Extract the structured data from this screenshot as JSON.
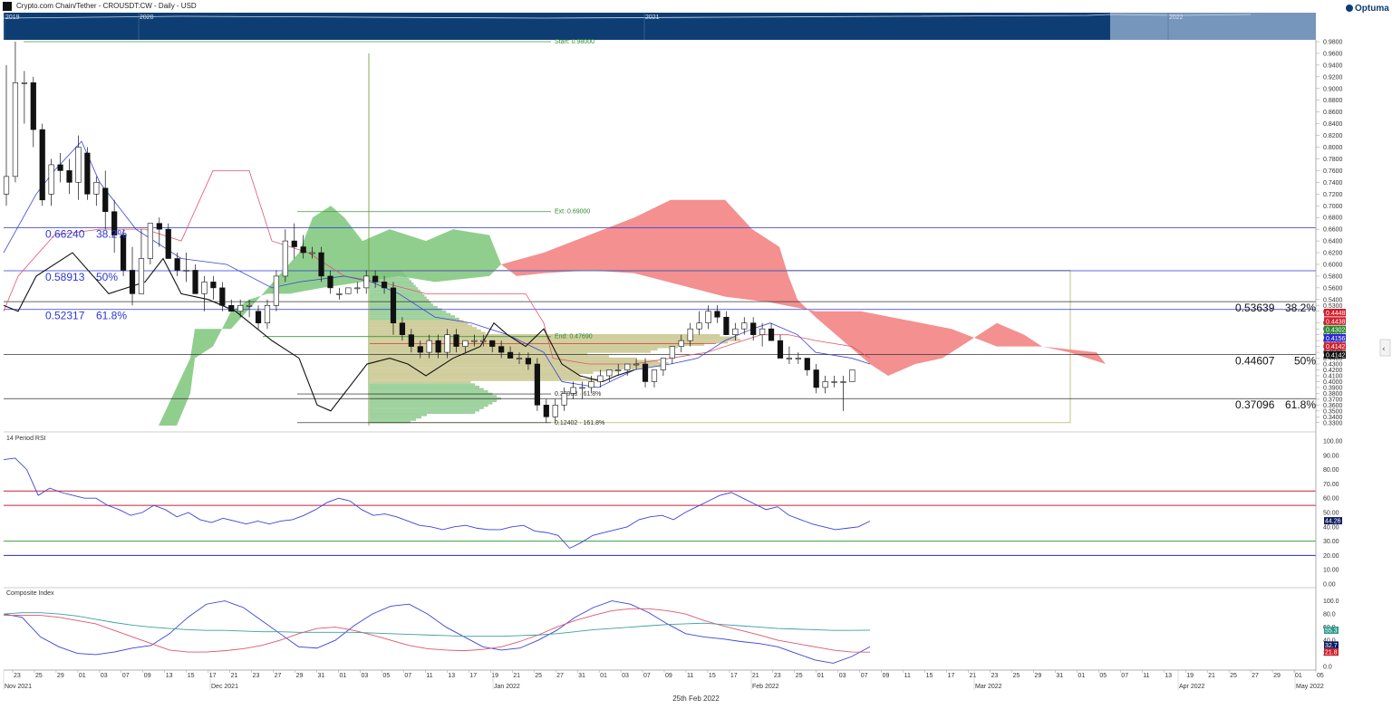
{
  "header": {
    "title": "Crypto.com Chain/Tether - CROUSDT:CW - Daily - USD",
    "logo": "Optuma",
    "navigator_years": [
      "2019",
      "2020",
      "2021",
      "2022"
    ],
    "footer_date": "25th Feb 2022"
  },
  "colors": {
    "bull_cloud": "#7dc67a",
    "bear_cloud": "#f27c7c",
    "tenkan": "#3a44d8",
    "kijun": "#e0566c",
    "lagging": "#111111",
    "volume_profile_green": "#8cc98c",
    "volume_profile_tan": "#c8c48c",
    "navigator_bg": "#0e3d73",
    "rsi_line": "#3a44d8",
    "rsi_upper": "#c8203a",
    "rsi_lower": "#3aa03a",
    "ci_line": "#3a44d8",
    "ci_fast_ma": "#e0566c",
    "ci_slow_ma": "#3aa0a0"
  },
  "chart_data": [
    {
      "type": "candlestick",
      "name": "price",
      "y_axis": [
        "0.9800",
        "0.9600",
        "0.9400",
        "0.9200",
        "0.9000",
        "0.8800",
        "0.8600",
        "0.8400",
        "0.8200",
        "0.8000",
        "0.7800",
        "0.7600",
        "0.7400",
        "0.7200",
        "0.7000",
        "0.6800",
        "0.6600",
        "0.6400",
        "0.6200",
        "0.6000",
        "0.5800",
        "0.5600",
        "0.5400",
        "0.5300",
        "0.5200",
        "0.5000",
        "0.4900",
        "0.4800",
        "0.4700",
        "0.4600",
        "0.4500",
        "0.4400",
        "0.4300",
        "0.4200",
        "0.4100",
        "0.4000",
        "0.3900",
        "0.3800",
        "0.3700",
        "0.3600",
        "0.3500",
        "0.3400",
        "0.3300"
      ],
      "ylim": [
        0.325,
        0.98
      ],
      "candles": [
        [
          0.72,
          0.94,
          0.7,
          0.75
        ],
        [
          0.75,
          0.98,
          0.74,
          0.91
        ],
        [
          0.91,
          0.93,
          0.84,
          0.91
        ],
        [
          0.91,
          0.92,
          0.8,
          0.83
        ],
        [
          0.83,
          0.84,
          0.7,
          0.71
        ],
        [
          0.72,
          0.78,
          0.7,
          0.77
        ],
        [
          0.77,
          0.79,
          0.74,
          0.76
        ],
        [
          0.76,
          0.78,
          0.72,
          0.74
        ],
        [
          0.74,
          0.82,
          0.71,
          0.8
        ],
        [
          0.79,
          0.8,
          0.71,
          0.72
        ],
        [
          0.72,
          0.75,
          0.7,
          0.74
        ],
        [
          0.73,
          0.76,
          0.66,
          0.69
        ],
        [
          0.69,
          0.71,
          0.62,
          0.65
        ],
        [
          0.65,
          0.66,
          0.58,
          0.59
        ],
        [
          0.59,
          0.63,
          0.53,
          0.55
        ],
        [
          0.55,
          0.66,
          0.55,
          0.61
        ],
        [
          0.61,
          0.67,
          0.6,
          0.67
        ],
        [
          0.67,
          0.68,
          0.63,
          0.66
        ],
        [
          0.66,
          0.67,
          0.61,
          0.61
        ],
        [
          0.61,
          0.62,
          0.58,
          0.59
        ],
        [
          0.59,
          0.62,
          0.57,
          0.59
        ],
        [
          0.59,
          0.6,
          0.55,
          0.55
        ],
        [
          0.55,
          0.58,
          0.52,
          0.57
        ],
        [
          0.57,
          0.58,
          0.54,
          0.56
        ],
        [
          0.56,
          0.57,
          0.52,
          0.53
        ],
        [
          0.53,
          0.54,
          0.52,
          0.52
        ],
        [
          0.52,
          0.54,
          0.51,
          0.53
        ],
        [
          0.53,
          0.54,
          0.51,
          0.53
        ],
        [
          0.52,
          0.53,
          0.49,
          0.5
        ],
        [
          0.5,
          0.54,
          0.49,
          0.53
        ],
        [
          0.53,
          0.59,
          0.52,
          0.58
        ],
        [
          0.58,
          0.66,
          0.57,
          0.64
        ],
        [
          0.64,
          0.67,
          0.61,
          0.63
        ],
        [
          0.63,
          0.65,
          0.61,
          0.62
        ],
        [
          0.62,
          0.63,
          0.61,
          0.62
        ],
        [
          0.62,
          0.63,
          0.57,
          0.58
        ],
        [
          0.58,
          0.59,
          0.55,
          0.56
        ],
        [
          0.55,
          0.56,
          0.54,
          0.55
        ],
        [
          0.55,
          0.56,
          0.55,
          0.56
        ],
        [
          0.56,
          0.57,
          0.55,
          0.56
        ],
        [
          0.56,
          0.59,
          0.55,
          0.58
        ],
        [
          0.58,
          0.59,
          0.56,
          0.57
        ],
        [
          0.57,
          0.58,
          0.55,
          0.56
        ],
        [
          0.56,
          0.57,
          0.48,
          0.5
        ],
        [
          0.5,
          0.51,
          0.47,
          0.48
        ],
        [
          0.48,
          0.49,
          0.45,
          0.46
        ],
        [
          0.46,
          0.47,
          0.44,
          0.45
        ],
        [
          0.45,
          0.48,
          0.44,
          0.47
        ],
        [
          0.47,
          0.48,
          0.44,
          0.45
        ],
        [
          0.45,
          0.49,
          0.44,
          0.48
        ],
        [
          0.48,
          0.49,
          0.45,
          0.46
        ],
        [
          0.46,
          0.47,
          0.45,
          0.47
        ],
        [
          0.47,
          0.48,
          0.46,
          0.47
        ],
        [
          0.47,
          0.48,
          0.46,
          0.47
        ],
        [
          0.47,
          0.47,
          0.45,
          0.46
        ],
        [
          0.46,
          0.47,
          0.44,
          0.45
        ],
        [
          0.45,
          0.46,
          0.44,
          0.44
        ],
        [
          0.44,
          0.45,
          0.43,
          0.44
        ],
        [
          0.44,
          0.45,
          0.42,
          0.43
        ],
        [
          0.43,
          0.44,
          0.35,
          0.36
        ],
        [
          0.36,
          0.37,
          0.33,
          0.34
        ],
        [
          0.34,
          0.37,
          0.33,
          0.36
        ],
        [
          0.36,
          0.39,
          0.35,
          0.38
        ],
        [
          0.38,
          0.4,
          0.37,
          0.39
        ],
        [
          0.39,
          0.4,
          0.37,
          0.39
        ],
        [
          0.39,
          0.41,
          0.38,
          0.4
        ],
        [
          0.4,
          0.42,
          0.39,
          0.41
        ],
        [
          0.41,
          0.42,
          0.4,
          0.42
        ],
        [
          0.42,
          0.43,
          0.41,
          0.42
        ],
        [
          0.42,
          0.43,
          0.41,
          0.43
        ],
        [
          0.43,
          0.44,
          0.42,
          0.43
        ],
        [
          0.43,
          0.44,
          0.39,
          0.4
        ],
        [
          0.4,
          0.42,
          0.39,
          0.42
        ],
        [
          0.42,
          0.44,
          0.41,
          0.44
        ],
        [
          0.44,
          0.46,
          0.43,
          0.46
        ],
        [
          0.46,
          0.48,
          0.45,
          0.47
        ],
        [
          0.47,
          0.5,
          0.46,
          0.49
        ],
        [
          0.49,
          0.52,
          0.48,
          0.5
        ],
        [
          0.5,
          0.53,
          0.49,
          0.52
        ],
        [
          0.52,
          0.53,
          0.5,
          0.51
        ],
        [
          0.51,
          0.52,
          0.48,
          0.48
        ],
        [
          0.48,
          0.5,
          0.47,
          0.49
        ],
        [
          0.49,
          0.51,
          0.48,
          0.5
        ],
        [
          0.5,
          0.51,
          0.47,
          0.48
        ],
        [
          0.48,
          0.5,
          0.46,
          0.49
        ],
        [
          0.49,
          0.5,
          0.47,
          0.47
        ],
        [
          0.47,
          0.48,
          0.44,
          0.44
        ],
        [
          0.44,
          0.46,
          0.43,
          0.44
        ],
        [
          0.44,
          0.45,
          0.43,
          0.44
        ],
        [
          0.44,
          0.44,
          0.41,
          0.42
        ],
        [
          0.42,
          0.43,
          0.38,
          0.39
        ],
        [
          0.39,
          0.41,
          0.38,
          0.4
        ],
        [
          0.4,
          0.41,
          0.39,
          0.4
        ],
        [
          0.4,
          0.41,
          0.35,
          0.4
        ],
        [
          0.4,
          0.42,
          0.4,
          0.42
        ]
      ],
      "fib_left": [
        {
          "value": "0.66240",
          "ratio": "38.2%",
          "y": 0.6624
        },
        {
          "value": "0.58913",
          "ratio": "50%",
          "y": 0.58913
        },
        {
          "value": "0.52317",
          "ratio": "61.8%",
          "y": 0.52317
        }
      ],
      "fib_right": [
        {
          "value": "0.53639",
          "ratio": "38.2%",
          "y": 0.53639
        },
        {
          "value": "0.44607",
          "ratio": "50%",
          "y": 0.44607
        },
        {
          "value": "0.37096",
          "ratio": "61.8%",
          "y": 0.37096
        }
      ],
      "annotations": {
        "start": "Start: 0.98000",
        "ext": "Ext: 0.69000",
        "end": "End: 0.47690",
        "fib618": "0.37908 · 61.8%",
        "fib1618": "0.12402 · 161.8%"
      },
      "price_tags": [
        {
          "label": "0.4448",
          "color": "#d0202c"
        },
        {
          "label": "0.4438",
          "color": "#d0202c"
        },
        {
          "label": "0.4302",
          "color": "#2e8a2e"
        },
        {
          "label": "0.4156",
          "color": "#2a2ad0"
        },
        {
          "label": "0.4142",
          "color": "#d0202c"
        },
        {
          "label": "0.4142",
          "color": "#111111"
        }
      ]
    },
    {
      "type": "line",
      "name": "14 Period RSI",
      "y_axis": [
        "100.00",
        "90.00",
        "80.00",
        "70.00",
        "60.00",
        "50.00",
        "40.00",
        "30.00",
        "20.00",
        "10.00",
        "0.00"
      ],
      "ylim": [
        0,
        100
      ],
      "levels": [
        65,
        55,
        30,
        20
      ],
      "series": [
        {
          "name": "",
          "values": [
            87,
            88,
            80,
            62,
            67,
            64,
            62,
            60,
            60,
            55,
            52,
            48,
            50,
            55,
            52,
            47,
            50,
            45,
            43,
            46,
            44,
            42,
            44,
            42,
            44,
            45,
            48,
            52,
            57,
            60,
            58,
            52,
            48,
            49,
            47,
            44,
            41,
            40,
            38,
            40,
            41,
            39,
            38,
            38,
            40,
            41,
            37,
            36,
            34,
            25,
            29,
            34,
            36,
            38,
            40,
            45,
            47,
            48,
            45,
            50,
            54,
            58,
            62,
            64,
            60,
            56,
            52,
            54,
            48,
            45,
            42,
            40,
            38,
            39,
            40,
            44
          ]
        }
      ],
      "last": "44.26"
    },
    {
      "type": "line",
      "name": "Composite Index",
      "y_axis": [
        "100.0",
        "80.0",
        "60.0",
        "40.0",
        "20.0",
        "0.0"
      ],
      "ylim": [
        0,
        105
      ],
      "series": [
        {
          "name": "",
          "values": [
            80,
            75,
            45,
            30,
            20,
            18,
            22,
            28,
            32,
            50,
            75,
            95,
            100,
            90,
            70,
            50,
            30,
            28,
            40,
            62,
            80,
            92,
            95,
            80,
            60,
            45,
            30,
            25,
            28,
            40,
            55,
            75,
            90,
            100,
            95,
            82,
            65,
            50,
            45,
            42,
            38,
            35,
            30,
            20,
            10,
            5,
            15,
            30
          ]
        },
        {
          "name": "",
          "values": [
            78,
            78,
            78,
            75,
            70,
            65,
            55,
            45,
            35,
            25,
            22,
            22,
            24,
            27,
            32,
            40,
            50,
            58,
            60,
            55,
            48,
            40,
            32,
            27,
            25,
            24,
            26,
            30,
            38,
            48,
            60,
            70,
            78,
            85,
            88,
            88,
            85,
            80,
            70,
            62,
            55,
            48,
            40,
            35,
            30,
            25,
            22,
            21.8
          ]
        },
        {
          "name": "",
          "values": [
            80,
            82,
            82,
            80,
            77,
            72,
            67,
            63,
            60,
            58,
            56,
            55,
            55,
            54,
            53,
            53,
            52,
            52,
            52,
            52,
            51,
            50,
            49,
            48,
            47,
            46,
            46,
            46,
            47,
            48,
            50,
            53,
            56,
            58,
            60,
            62,
            64,
            65,
            66,
            64,
            62,
            60,
            58,
            57,
            56,
            55,
            55,
            55.3
          ]
        }
      ],
      "last": [
        "55.3",
        "32.7",
        "21.8"
      ]
    }
  ],
  "x_axis": {
    "days": [
      "23",
      "25",
      "29",
      "01",
      "03",
      "07",
      "09",
      "13",
      "15",
      "17",
      "21",
      "23",
      "27",
      "29",
      "31",
      "01",
      "03",
      "05",
      "07",
      "11",
      "13",
      "17",
      "19",
      "21",
      "25",
      "27",
      "31",
      "01",
      "03",
      "07",
      "09",
      "11",
      "15",
      "17",
      "21",
      "23",
      "25",
      "01",
      "03",
      "07",
      "09",
      "11",
      "15",
      "17",
      "21",
      "23",
      "25",
      "29",
      "31",
      "01",
      "05",
      "07",
      "11",
      "13",
      "19",
      "21",
      "25",
      "27",
      "29",
      "01",
      "05"
    ],
    "months": [
      "Nov 2021",
      "Dec 2021",
      "Jan 2022",
      "Feb 2022",
      "Mar 2022",
      "Apr 2022",
      "May 2022"
    ]
  },
  "rsi_title": "14 Period RSI",
  "ci_title": "Composite Index"
}
